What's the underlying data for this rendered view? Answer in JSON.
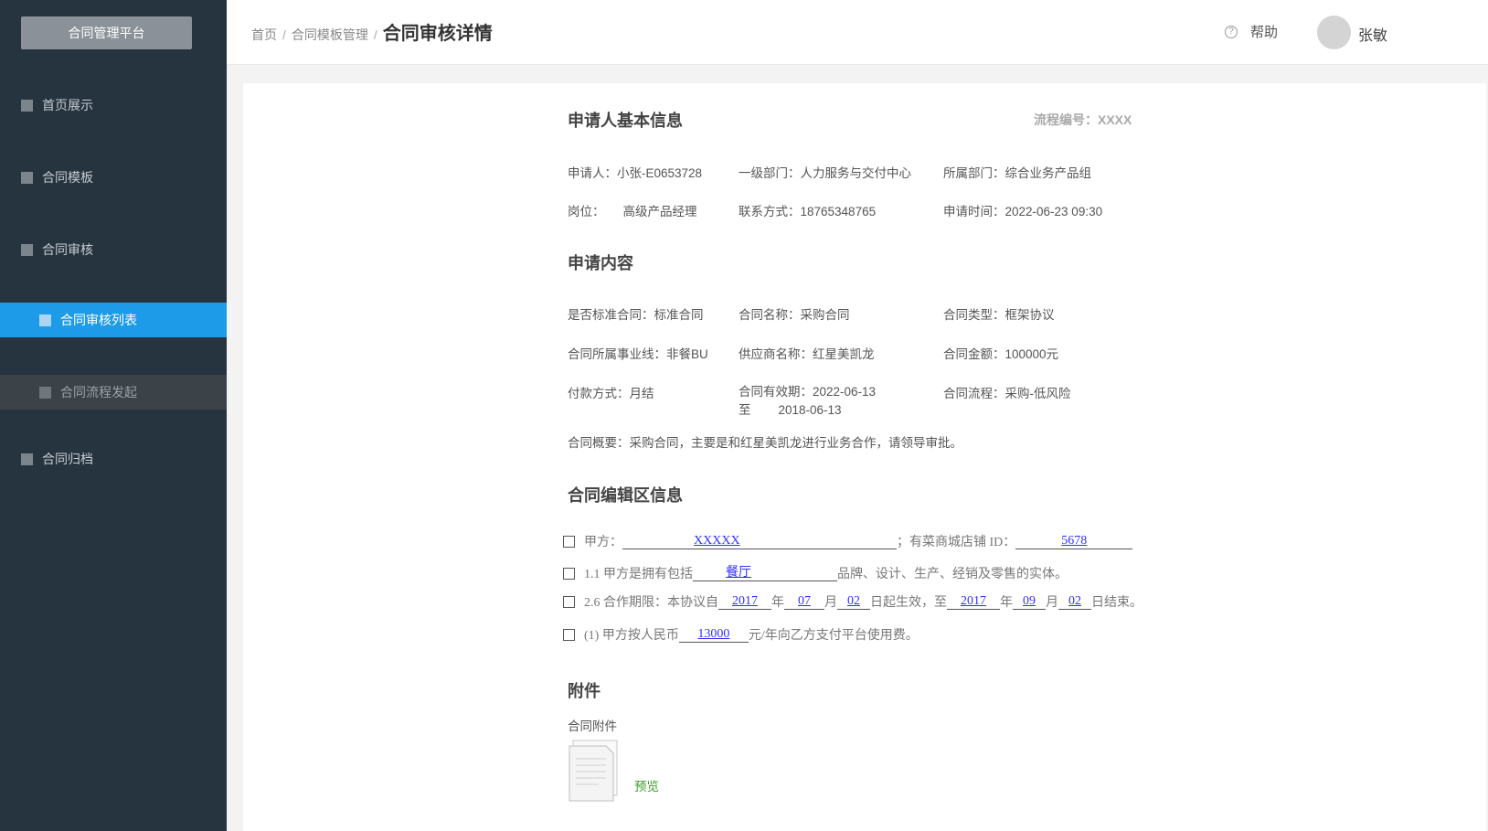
{
  "sidebar": {
    "brand": "合同管理平台",
    "items": [
      {
        "label": "首页展示"
      },
      {
        "label": "合同模板"
      },
      {
        "label": "合同审核"
      },
      {
        "label": "合同审核列表"
      },
      {
        "label": "合同流程发起"
      },
      {
        "label": "合同归档"
      }
    ]
  },
  "header": {
    "breadcrumb": [
      "首页",
      "合同模板管理",
      "合同审核详情"
    ],
    "separator": "/",
    "help_label": "帮助",
    "username": "张敏"
  },
  "applicant": {
    "title": "申请人基本信息",
    "flow_no": "流程编号：XXXX",
    "fields": [
      {
        "label": "申请人：",
        "value": "小张-E0653728"
      },
      {
        "label": "一级部门：",
        "value": "人力服务与交付中心"
      },
      {
        "label": "所属部门：",
        "value": "综合业务产品组"
      },
      {
        "label": "岗位：",
        "value": "高级产品经理"
      },
      {
        "label": "联系方式：",
        "value": "18765348765"
      },
      {
        "label": "申请时间：",
        "value": "2022-06-23 09:30"
      }
    ]
  },
  "content": {
    "title": "申请内容",
    "fields": [
      {
        "label": "是否标准合同：",
        "value": "标准合同"
      },
      {
        "label": "合同名称：",
        "value": "采购合同"
      },
      {
        "label": "合同类型：",
        "value": "框架协议"
      },
      {
        "label": "合同所属事业线：",
        "value": "非餐BU"
      },
      {
        "label": "供应商名称：",
        "value": "红星美凯龙"
      },
      {
        "label": "合同金额：",
        "value": "100000元"
      },
      {
        "label": "付款方式：",
        "value": "月结"
      },
      {
        "label": "合同有效期：",
        "value": "2022-06-13",
        "to_label": "至",
        "to_value": "2018-06-13"
      },
      {
        "label": "合同流程：",
        "value": "采购-低风险"
      },
      {
        "label": "合同概要：",
        "value": "采购合同，主要是和红星美凯龙进行业务合作，请领导审批。"
      }
    ]
  },
  "edit": {
    "title": "合同编辑区信息",
    "clause1": {
      "t1": "甲方：",
      "v1": "XXXXX",
      "t2": "；有菜商城店铺 ID：",
      "v2": "5678"
    },
    "clause2": {
      "t1": "1.1  甲方是拥有包括",
      "v1": "餐厅",
      "t2": "品牌、设计、生产、经销及零售的实体。"
    },
    "clause3": {
      "t1": "2.6  合作期限：本协议自",
      "y1": "2017",
      "m1": "07",
      "d1": "02",
      "mid": "日起生效，至",
      "y2": "2017",
      "m2": "09",
      "d2": "02",
      "end": "日结束。",
      "nian": "年",
      "yue": "月"
    },
    "clause4": {
      "t1": "(1)  甲方按人民币",
      "v1": "13000",
      "t2": "元/年向乙方支付平台使用费。"
    }
  },
  "attachment": {
    "title": "附件",
    "label": "合同附件",
    "preview": "预览"
  }
}
